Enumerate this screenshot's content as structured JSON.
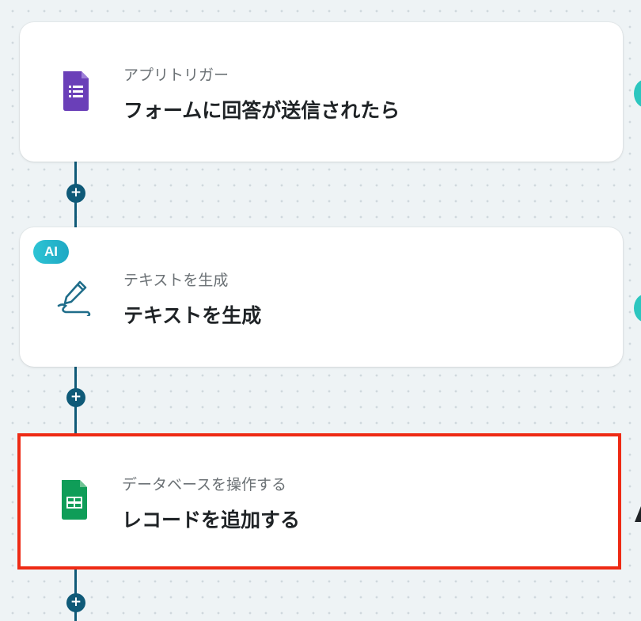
{
  "flow": {
    "steps": [
      {
        "subtitle": "アプリトリガー",
        "title": "フォームに回答が送信されたら",
        "icon": "google-forms-icon"
      },
      {
        "badge": "AI",
        "subtitle": "テキストを生成",
        "title": "テキストを生成",
        "icon": "pen-stroke-icon"
      },
      {
        "subtitle": "データベースを操作する",
        "title": "レコードを追加する",
        "icon": "google-sheets-icon",
        "selected": true
      }
    ],
    "add_step_symbol": "+"
  },
  "colors": {
    "connector": "#0f5a78",
    "selection_border": "#ee2a14",
    "ai_badge": "#2dc4d4",
    "forms_purple": "#673ab7",
    "sheets_green": "#0f9d58",
    "accent_teal": "#2cc6bf"
  }
}
